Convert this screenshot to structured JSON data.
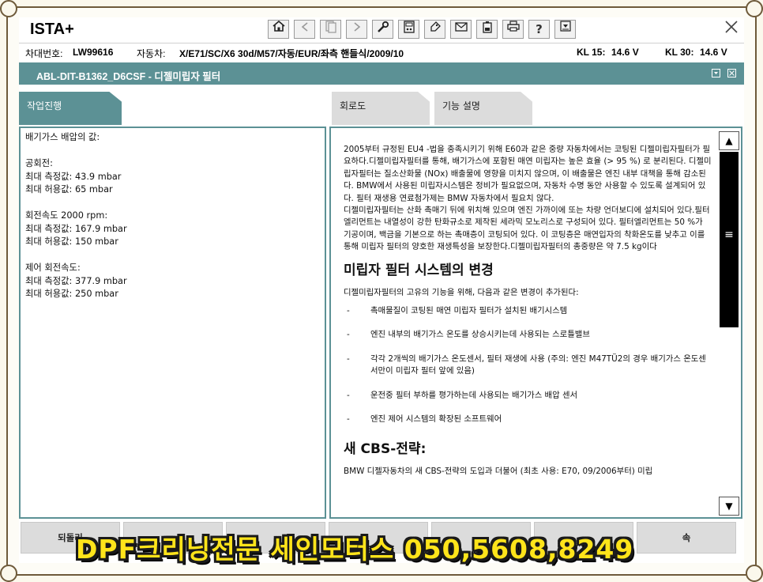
{
  "app": {
    "title": "ISTA+"
  },
  "toolbar": {
    "icons": [
      "home-icon",
      "back-icon",
      "document-icon",
      "forward-icon",
      "wrench-icon",
      "measurement-icon",
      "tag-icon",
      "mail-icon",
      "battery-icon",
      "print-icon",
      "help-icon",
      "dropdown-icon",
      "close-icon"
    ],
    "help_glyph": "?"
  },
  "vehicle": {
    "vin_label": "차대번호:",
    "vin_value": "LW99616",
    "car_label": "자동차:",
    "car_value": "X/E71/SC/X6 30d/M57/자동/EUR/좌측 핸들식/2009/10",
    "kl15_label": "KL 15:",
    "kl15_value": "14.6 V",
    "kl30_label": "KL 30:",
    "kl30_value": "14.6 V"
  },
  "module": {
    "title": "ABL-DIT-B1362_D6CSF - 디젤미립자 필터"
  },
  "tabs": {
    "progress": "작업진행",
    "circuit": "회로도",
    "function": "기능 설명"
  },
  "left_panel": {
    "lines": [
      "배기가스 배압의 값:",
      "",
      "공회전:",
      "최대 측정값: 43.9 mbar",
      "최대 허용값: 65  mbar",
      "",
      "회전속도 2000 rpm:",
      "최대 측정값: 167.9 mbar",
      "최대 허용값: 150  mbar",
      "",
      "제어 회전속도:",
      "최대 측정값: 377.9 mbar",
      "최대 허용값: 250 mbar"
    ]
  },
  "right_panel": {
    "para1": "2005부터 규정된 EU4 -법을 충족시키기 위해 E60과 같은 중량 자동차에서는 코팅된 디젤미립자필터가 필요하다.디젤미립자필터를 통해, 배기가스에 포함된 매연 미립자는 높은 효율 (> 95 %) 로 분리된다. 디젤미립자필터는 질소산화물 (NOx) 배출물에 영향을 미치지 않으며, 이 배출물은 엔진 내부 대책을 통해 감소된다. BMW에서 사용된 미립자시스템은 정비가 필요없으며, 자동차 수명 동안 사용할 수 있도록 설계되어 있다. 필터 재생용 연료첨가제는 BMW 자동차에서 필요치 않다.",
    "para2": "디젤미립자필터는 산화 촉매기 뒤에 위치해 있으며 엔진 가까이에 또는 차량 언더보디에 설치되어 있다.필터엘리먼트는 내열성이 강한 탄화규소로 제작된 세라믹 모노리스로 구성되어 있다. 필터엘리먼트는 50 %가 기공이며, 백금을 기본으로 하는 촉매층이 코팅되어 있다. 이 코팅층은 매연입자의 착화온도를 낮추고 이를 통해 미립자 필터의 양호한 재생특성을 보장한다.디젤미립자필터의 총중량은 약 7.5 kg이다",
    "heading1": "미립자 필터 시스템의 변경",
    "intro": "디젤미립자필터의 고유의 기능을 위해, 다음과 같은 변경이 추가된다:",
    "bullet_dash": "-",
    "bullets": [
      "촉매물질이 코팅된 매연 미립자 필터가 설치된 배기시스템",
      "엔진 내부의 배기가스 온도를 상승시키는데 사용되는 스로틀밸브",
      "각각 2개씩의 배기가스 온도센서, 필터 재생에 사용 (주의: 엔진 M47TÜ2의 경우 배기가스 온도센서만이 미립자 필터 앞에 있음)",
      "운전중 필터 부하를 평가하는데 사용되는 배기가스 배압 센서",
      "엔진 제어 시스템의 확장된 소프트웨어"
    ],
    "heading2": "새 CBS-전략:",
    "para3": "BMW 디젤자동차의 새 CBS-전략의 도입과 더불어 (최초 사용: E70, 09/2006부터) 미립"
  },
  "scrollbar": {
    "up": "▲",
    "down": "▼",
    "grip": "≡"
  },
  "bottom_buttons": {
    "back": "되돌리",
    "continue": "속"
  },
  "overlay": {
    "banner": "DPF크리닝전문 세인모터스 050,5608,8249"
  },
  "colors": {
    "teal": "#5c9195",
    "banner_yellow": "#ffe41a"
  }
}
